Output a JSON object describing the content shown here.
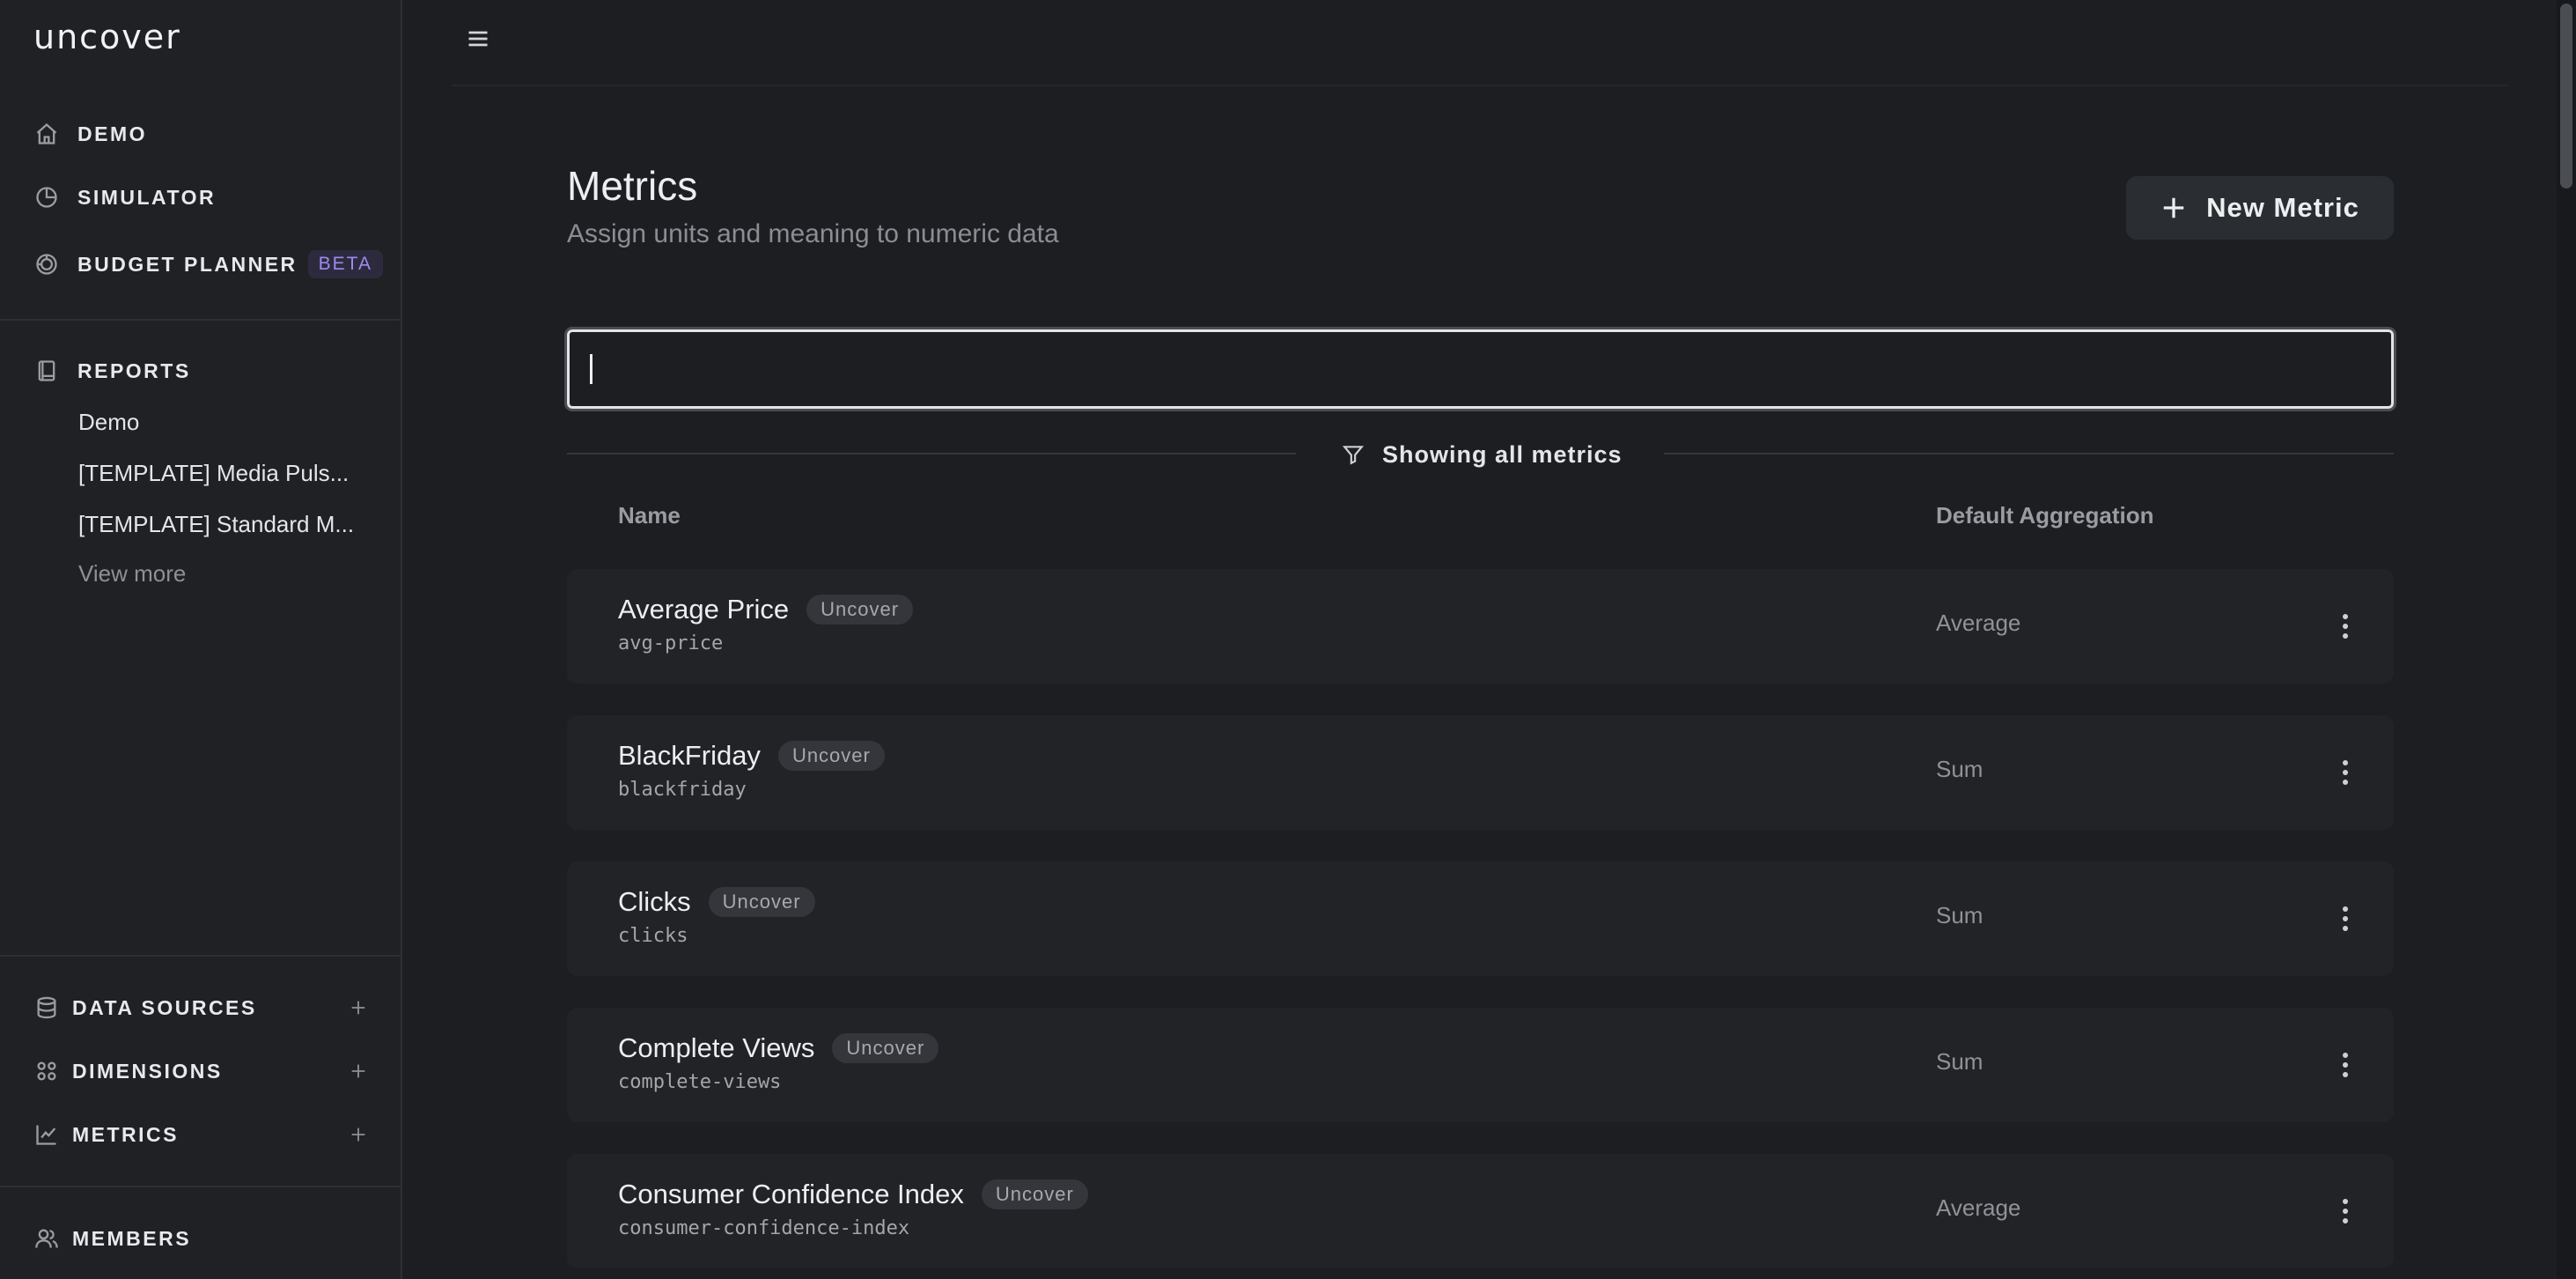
{
  "app": {
    "logo": "uncover"
  },
  "sidebar": {
    "top_items": [
      {
        "label": "DEMO",
        "icon": "home-icon"
      },
      {
        "label": "SIMULATOR",
        "icon": "pie-chart-icon"
      },
      {
        "label": "BUDGET PLANNER",
        "icon": "budget-icon",
        "badge": "BETA"
      }
    ],
    "reports": {
      "label": "REPORTS",
      "icon": "book-icon",
      "items": [
        "Demo",
        "[TEMPLATE] Media Puls...",
        "[TEMPLATE] Standard M..."
      ],
      "view_more": "View more"
    },
    "bottom_items": [
      {
        "label": "DATA SOURCES",
        "icon": "database-icon"
      },
      {
        "label": "DIMENSIONS",
        "icon": "dimensions-icon"
      },
      {
        "label": "METRICS",
        "icon": "line-chart-icon"
      }
    ],
    "members": {
      "label": "MEMBERS",
      "icon": "users-icon"
    }
  },
  "header": {
    "title": "Metrics",
    "subtitle": "Assign units and meaning to numeric data",
    "new_button": "New Metric"
  },
  "search": {
    "value": "",
    "placeholder": ""
  },
  "filter": {
    "label": "Showing all metrics"
  },
  "table": {
    "columns": {
      "name": "Name",
      "aggregation": "Default Aggregation"
    },
    "rows": [
      {
        "name": "Average Price",
        "badge": "Uncover",
        "slug": "avg-price",
        "aggregation": "Average"
      },
      {
        "name": "BlackFriday",
        "badge": "Uncover",
        "slug": "blackfriday",
        "aggregation": "Sum"
      },
      {
        "name": "Clicks",
        "badge": "Uncover",
        "slug": "clicks",
        "aggregation": "Sum"
      },
      {
        "name": "Complete Views",
        "badge": "Uncover",
        "slug": "complete-views",
        "aggregation": "Sum"
      },
      {
        "name": "Consumer Confidence Index",
        "badge": "Uncover",
        "slug": "consumer-confidence-index",
        "aggregation": "Average"
      }
    ]
  }
}
